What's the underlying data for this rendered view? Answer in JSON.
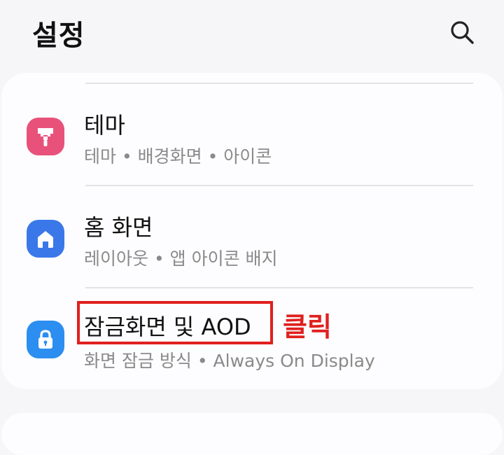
{
  "header": {
    "title": "설정",
    "search_icon": "search-icon"
  },
  "settings": {
    "items": [
      {
        "title": "테마",
        "subtitle": "테마 • 배경화면 • 아이콘",
        "icon": "paint-roller-icon",
        "icon_color": "#e8527a"
      },
      {
        "title": "홈 화면",
        "subtitle": "레이아웃 • 앱 아이콘 배지",
        "icon": "home-icon",
        "icon_color": "#3a78ea"
      },
      {
        "title": "잠금화면 및 AOD",
        "subtitle": "화면 잠금 방식 • Always On Display",
        "icon": "lock-icon",
        "icon_color": "#2b8ef0"
      }
    ]
  },
  "annotation": {
    "label": "클릭",
    "color": "#e0201e"
  }
}
